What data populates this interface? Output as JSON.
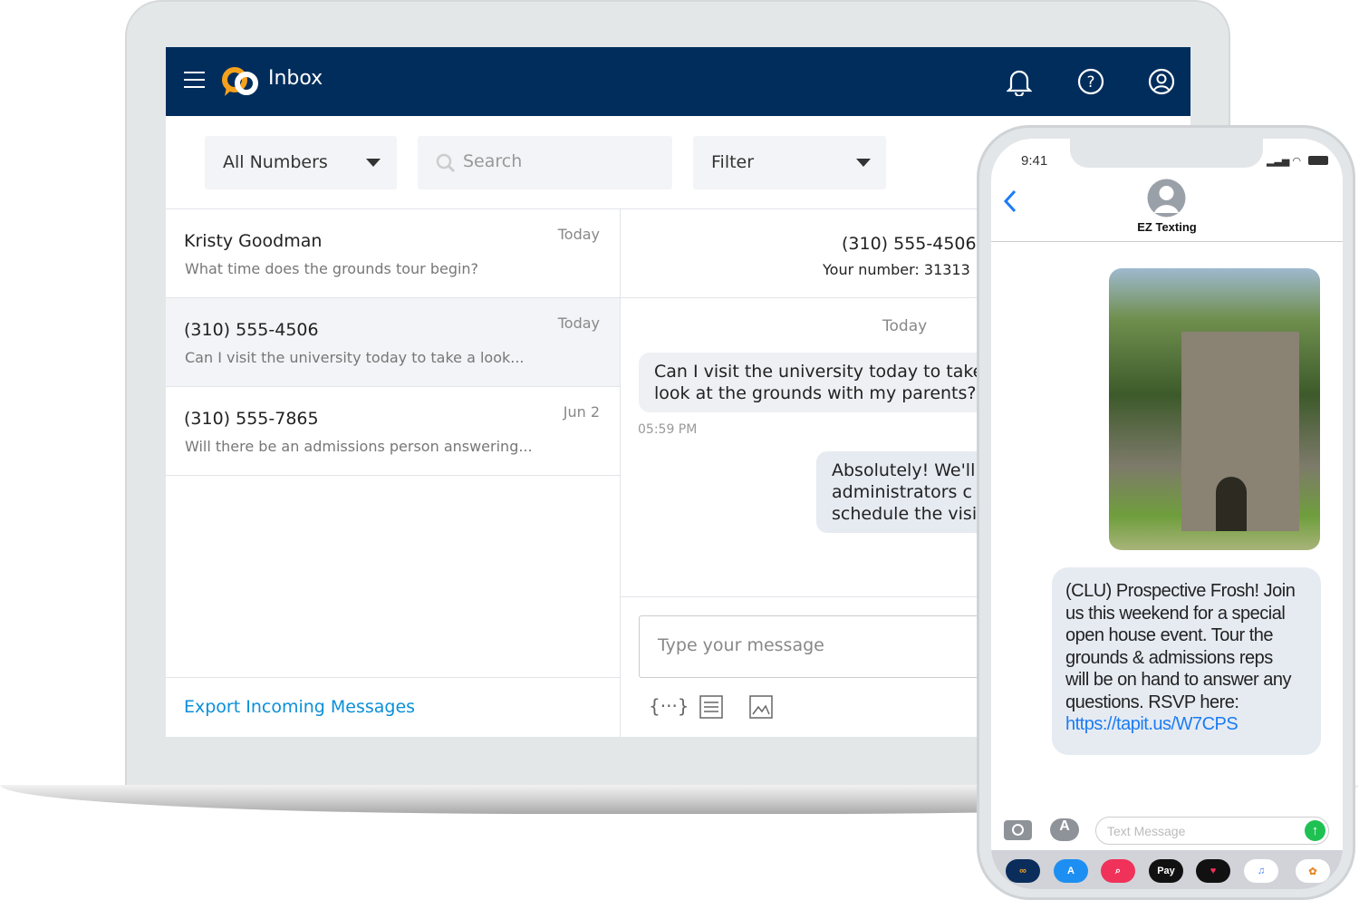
{
  "header": {
    "title": "Inbox",
    "icons": [
      "menu-icon",
      "logo",
      "bell-icon",
      "help-icon",
      "account-icon"
    ]
  },
  "toolbar": {
    "numbers_select": "All Numbers",
    "search_placeholder": "Search",
    "filter_select": "Filter"
  },
  "conversations": [
    {
      "name": "Kristy Goodman",
      "preview": "What time does the grounds tour begin?",
      "date": "Today"
    },
    {
      "name": "(310) 555-4506",
      "preview": "Can I visit the university today to take a look...",
      "date": "Today",
      "selected": true
    },
    {
      "name": "(310) 555-7865",
      "preview": "Will there be an admissions person answering...",
      "date": "Jun 2"
    }
  ],
  "export_label": "Export Incoming Messages",
  "thread": {
    "contact": "(310) 555-4506",
    "your_number": "Your number: 31313",
    "day": "Today",
    "incoming": [
      "Can I visit the university today to take a",
      "look at the grounds with my parents?"
    ],
    "incoming_time": "05:59 PM",
    "outgoing": [
      "Absolutely! We'll",
      "administrators c",
      "schedule the visi"
    ],
    "input_placeholder": "Type your message"
  },
  "phone": {
    "time": "9:41",
    "contact": "EZ Texting",
    "message": [
      "(CLU) Prospective Frosh! Join",
      "us this weekend for a special",
      "open house event. Tour the",
      "grounds & admissions reps",
      "will be on hand to answer any",
      "questions. RSVP here:"
    ],
    "link": "https://tapit.us/W7CPS",
    "input_placeholder": "Text Message",
    "apps": [
      "EZ",
      "A",
      "",
      "Pay",
      "",
      "♫",
      ""
    ]
  },
  "colors": {
    "navy": "#002d5c",
    "accent": "#0a8fd8",
    "orange": "#f5a11c",
    "ios_blue": "#1a7cf5"
  }
}
